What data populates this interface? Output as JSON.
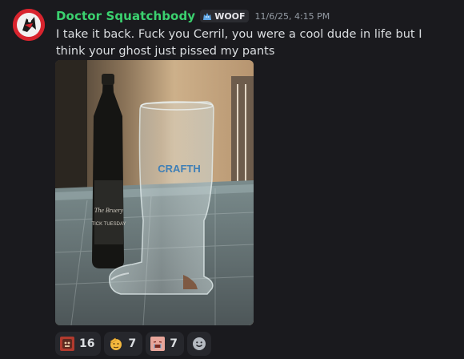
{
  "message": {
    "author": "Doctor Squatchbody",
    "tag": {
      "label": "WOOF",
      "icon": "wolf-icon"
    },
    "timestamp": "11/6/25, 4:15 PM",
    "text": "I take it back. Fuck you Cerril, you were a cool dude in life but I think your ghost just pissed my pants",
    "avatar_icon": "squatch-avatar-icon",
    "attachment": {
      "type": "photo",
      "bottle_label": "TICK TUESDAY",
      "bottle_brand": "The Bruery",
      "glass_print": "CRAFTH"
    }
  },
  "reactions": [
    {
      "icon": "custom-face-emoji-icon",
      "count": "16"
    },
    {
      "icon": "saluting-face-emoji-icon",
      "count": "7"
    },
    {
      "icon": "custom-crying-face-emoji-icon",
      "count": "7"
    }
  ],
  "add_reaction_icon": "add-reaction-icon",
  "colors": {
    "background": "#1a1a1e",
    "username": "#3bd16f",
    "text": "#dbdee1",
    "timestamp": "#949ba4",
    "reaction_bg": "#26272c"
  }
}
